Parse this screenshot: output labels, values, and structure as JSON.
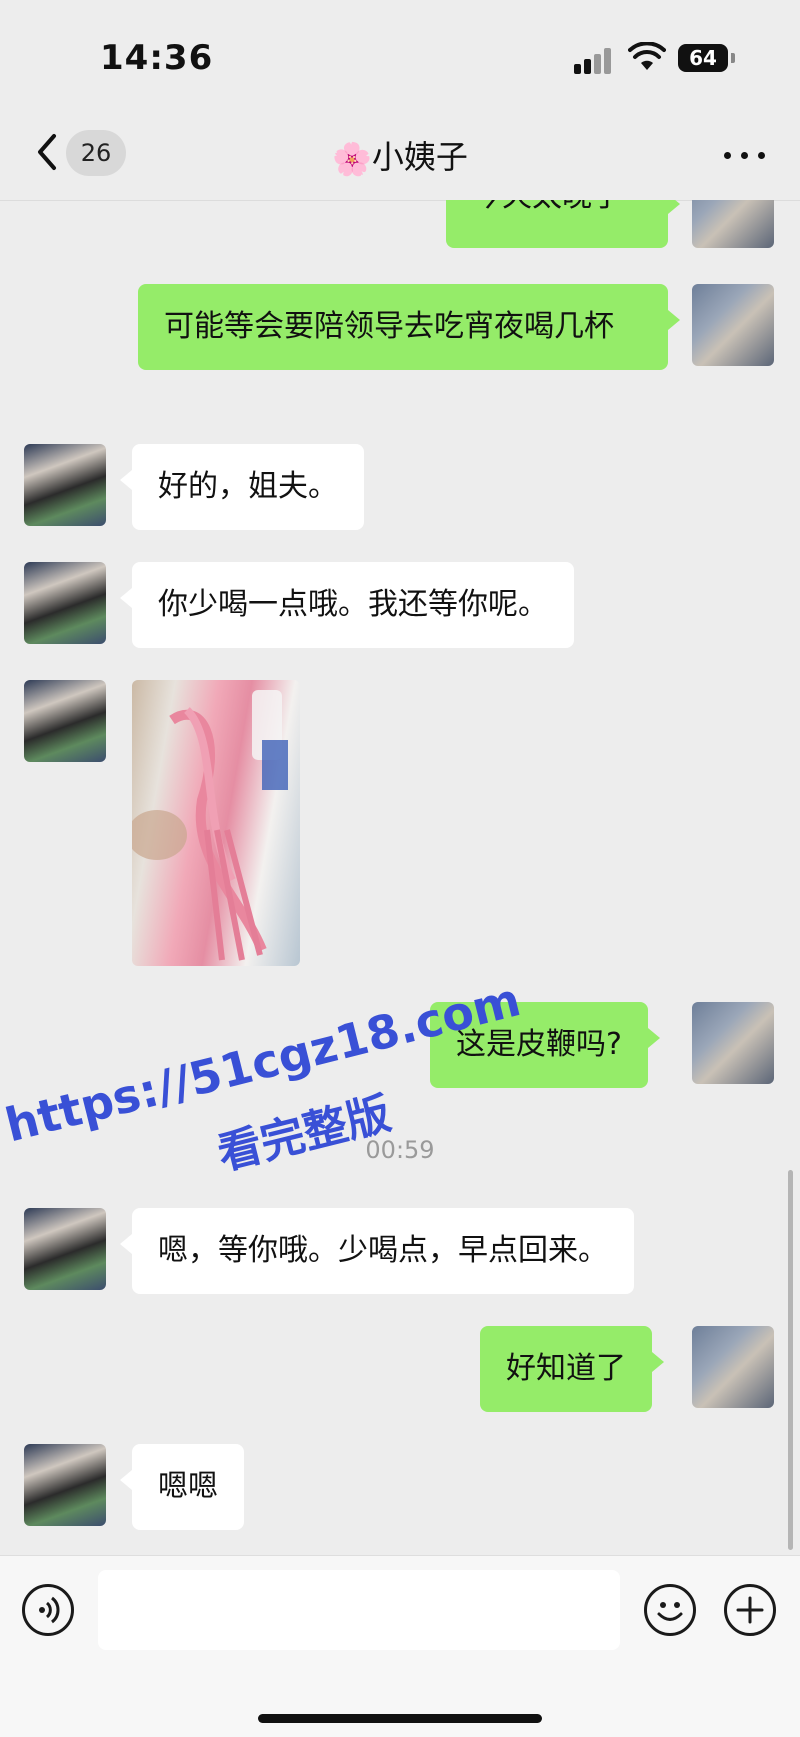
{
  "status_bar": {
    "time": "14:36",
    "battery": "64"
  },
  "nav": {
    "back_count": "26",
    "title_icon": "🌸",
    "title": "小姨子"
  },
  "messages": [
    {
      "side": "me",
      "text": "今天太晚了"
    },
    {
      "side": "me",
      "text": "可能等会要陪领导去吃宵夜喝几杯"
    },
    {
      "side": "them",
      "text": "好的，姐夫。"
    },
    {
      "side": "them",
      "text": "你少喝一点哦。我还等你呢。"
    },
    {
      "side": "them",
      "type": "image"
    },
    {
      "side": "me",
      "text": "这是皮鞭吗?"
    },
    {
      "type": "timestamp",
      "text": "00:59"
    },
    {
      "side": "them",
      "text": "嗯，等你哦。少喝点，早点回来。"
    },
    {
      "side": "me",
      "text": "好知道了"
    },
    {
      "side": "them",
      "text": "嗯嗯"
    }
  ],
  "watermark": {
    "line1": "https://51cgz18.com",
    "line2": "看完整版"
  },
  "icons": {
    "back": "chevron-left-icon",
    "more": "more-dots-icon",
    "voice": "voice-icon",
    "emoji": "emoji-icon",
    "plus": "plus-icon"
  },
  "colors": {
    "my_bubble": "#95ec69",
    "their_bubble": "#ffffff",
    "background": "#ededed",
    "watermark": "#3950d6"
  }
}
